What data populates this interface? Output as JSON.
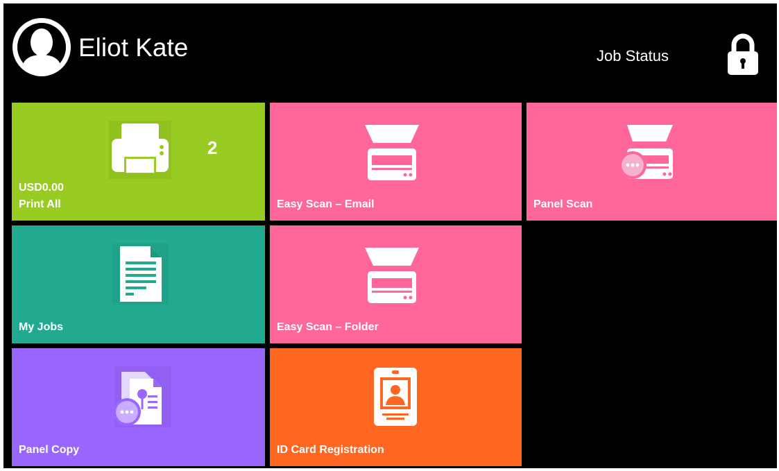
{
  "header": {
    "user_name": "Eliot Kate",
    "job_status_label": "Job Status",
    "avatar_icon": "user-avatar-icon",
    "lock_icon": "lock-icon"
  },
  "tiles": [
    {
      "label": "Print All",
      "sublabel": "USD0.00",
      "count": "2",
      "icon": "printer-icon",
      "color": "#99CC22"
    },
    {
      "label": "Easy Scan – Email",
      "icon": "scanner-icon",
      "color": "#FF6699"
    },
    {
      "label": "Panel Scan",
      "icon": "scanner-more-icon",
      "color": "#FF6699"
    },
    {
      "label": "My Jobs",
      "icon": "document-icon",
      "color": "#22AA90"
    },
    {
      "label": "Easy Scan – Folder",
      "icon": "scanner-icon",
      "color": "#FF6699"
    },
    {
      "label": "Panel Copy",
      "icon": "copy-more-icon",
      "color": "#9966FF"
    },
    {
      "label": "ID Card Registration",
      "icon": "id-card-icon",
      "color": "#FF6622"
    }
  ]
}
